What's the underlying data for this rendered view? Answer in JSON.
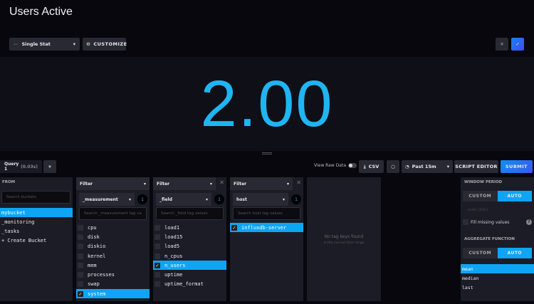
{
  "header": {
    "title": "Users Active",
    "viz_type": "Single Stat",
    "customize_label": "CUSTOMIZE",
    "cancel_icon": "close-icon",
    "confirm_icon": "check-icon"
  },
  "stat": {
    "value": "2.00",
    "color": "#1fb5f2"
  },
  "query_bar": {
    "tab_label": "Query 1",
    "tab_time": "(0.03s)",
    "add_label": "+",
    "view_raw_label": "View Raw Data",
    "csv_label": "CSV",
    "time_range": "Past 15m",
    "script_editor_label": "SCRIPT EDITOR",
    "submit_label": "SUBMIT"
  },
  "from": {
    "label": "FROM",
    "search_placeholder": "Search buckets",
    "buckets": [
      "mybucket",
      "_monitoring",
      "_tasks",
      "+ Create Bucket"
    ],
    "selected": "mybucket"
  },
  "filters": [
    {
      "header": "Filter",
      "key": "_measurement",
      "count": "1",
      "search_placeholder": "Search _measurement tag va",
      "items": [
        {
          "label": "cpu",
          "checked": false
        },
        {
          "label": "disk",
          "checked": false
        },
        {
          "label": "diskio",
          "checked": false
        },
        {
          "label": "kernel",
          "checked": false
        },
        {
          "label": "mem",
          "checked": false
        },
        {
          "label": "processes",
          "checked": false
        },
        {
          "label": "swap",
          "checked": false
        },
        {
          "label": "system",
          "checked": true
        }
      ]
    },
    {
      "header": "Filter",
      "key": "_field",
      "count": "1",
      "search_placeholder": "Search _field tag values",
      "items": [
        {
          "label": "load1",
          "checked": false
        },
        {
          "label": "load15",
          "checked": false
        },
        {
          "label": "load5",
          "checked": false
        },
        {
          "label": "n_cpus",
          "checked": false
        },
        {
          "label": "n_users",
          "checked": true
        },
        {
          "label": "uptime",
          "checked": false
        },
        {
          "label": "uptime_format",
          "checked": false
        }
      ]
    },
    {
      "header": "Filter",
      "key": "host",
      "count": "1",
      "search_placeholder": "Search host tag values",
      "items": [
        {
          "label": "influxdb-server",
          "checked": true
        }
      ]
    }
  ],
  "empty_panel": {
    "message": "No tag keys found",
    "sub": "in the current time range"
  },
  "aggregate": {
    "window_period_label": "WINDOW PERIOD",
    "custom_label": "CUSTOM",
    "auto_label": "AUTO",
    "window_value": "auto (10s)",
    "fill_missing_label": "Fill missing values",
    "aggregate_label": "AGGREGATE FUNCTION",
    "functions": [
      "mean",
      "median",
      "last"
    ],
    "selected": "mean"
  }
}
